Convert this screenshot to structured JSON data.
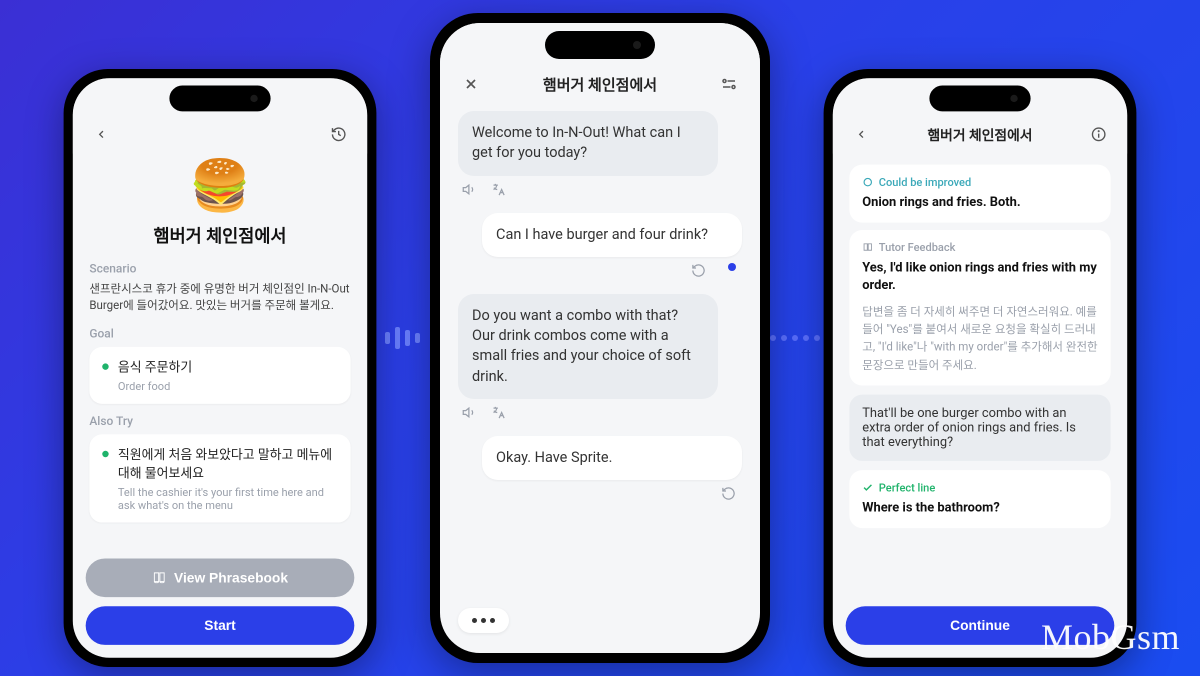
{
  "watermark": "MobGsm",
  "phone1": {
    "title": "햄버거 체인점에서",
    "scenario_label": "Scenario",
    "scenario_text": "샌프란시스코 휴가 중에 유명한 버거 체인점인 In-N-Out Burger에 들어갔어요. 맛있는 버거를 주문해 볼게요.",
    "goal_label": "Goal",
    "goal_ko": "음식 주문하기",
    "goal_en": "Order food",
    "also_try_label": "Also Try",
    "also_try_ko": "직원에게 처음 와보았다고 말하고 메뉴에 대해 물어보세요",
    "also_try_en": "Tell the cashier it's your first time here and ask what's on the menu",
    "phrasebook_btn": "View Phrasebook",
    "start_btn": "Start"
  },
  "phone2": {
    "title": "햄버거 체인점에서",
    "msg1": "Welcome to In-N-Out! What can I get for you today?",
    "msg2": "Can I have burger and four drink?",
    "msg3": "Do you want a combo with that? Our drink combos come with a small fries and your choice of soft drink.",
    "msg4": "Okay. Have Sprite."
  },
  "phone3": {
    "title": "햄버거 체인점에서",
    "improve_label": "Could be improved",
    "improve_text": "Onion rings and fries. Both.",
    "tutor_label": "Tutor Feedback",
    "tutor_text": "Yes, I'd like onion rings and fries with my order.",
    "tutor_expl": "답변을 좀 더 자세히 써주면 더 자연스러워요. 예를 들어 \"Yes\"를 붙여서 새로운 요청을 확실히 드러내고, \"I'd like\"나 \"with my order\"를 추가해서 완전한 문장으로 만들어 주세요.",
    "bot_reply": "That'll be one burger combo with an extra order of onion rings and fries. Is that everything?",
    "perfect_label": "Perfect line",
    "perfect_text": "Where is the bathroom?",
    "continue_btn": "Continue"
  }
}
